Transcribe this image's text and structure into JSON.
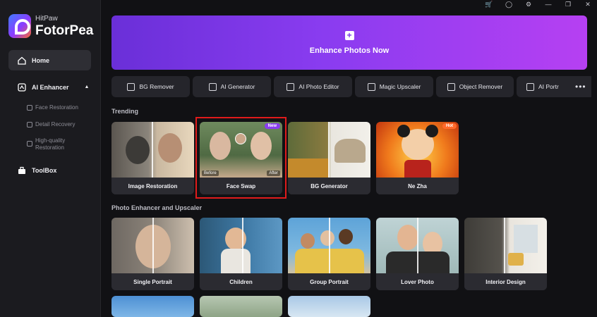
{
  "app": {
    "brand_small": "HitPaw",
    "brand_big": "FotorPea"
  },
  "sidebar": {
    "home": "Home",
    "ai_enhancer": "AI Enhancer",
    "sub_items": [
      "Face Restoration",
      "Detail Recovery",
      "High-quality Restoration"
    ],
    "toolbox": "ToolBox"
  },
  "banner": {
    "label": "Enhance Photos Now",
    "plus": "+"
  },
  "tools": [
    "BG Remover",
    "AI Generator",
    "AI Photo Editor",
    "Magic Upscaler",
    "Object Remover",
    "AI Portr"
  ],
  "more": "•••",
  "sections": {
    "trending": "Trending",
    "enhancer": "Photo Enhancer and Upscaler"
  },
  "trending": [
    {
      "label": "Image Restoration"
    },
    {
      "label": "Face Swap",
      "badge": "New",
      "before": "Before",
      "after": "After"
    },
    {
      "label": "BG Generator"
    },
    {
      "label": "Ne Zha",
      "badge": "Hot"
    }
  ],
  "enhancer": [
    {
      "label": "Single Portrait"
    },
    {
      "label": "Children"
    },
    {
      "label": "Group Portrait"
    },
    {
      "label": "Lover Photo"
    },
    {
      "label": "Interior Design"
    }
  ],
  "colors": {
    "accent": "#8a3cf0",
    "highlight": "#e01b1b",
    "hot": "#ff6a2b"
  }
}
